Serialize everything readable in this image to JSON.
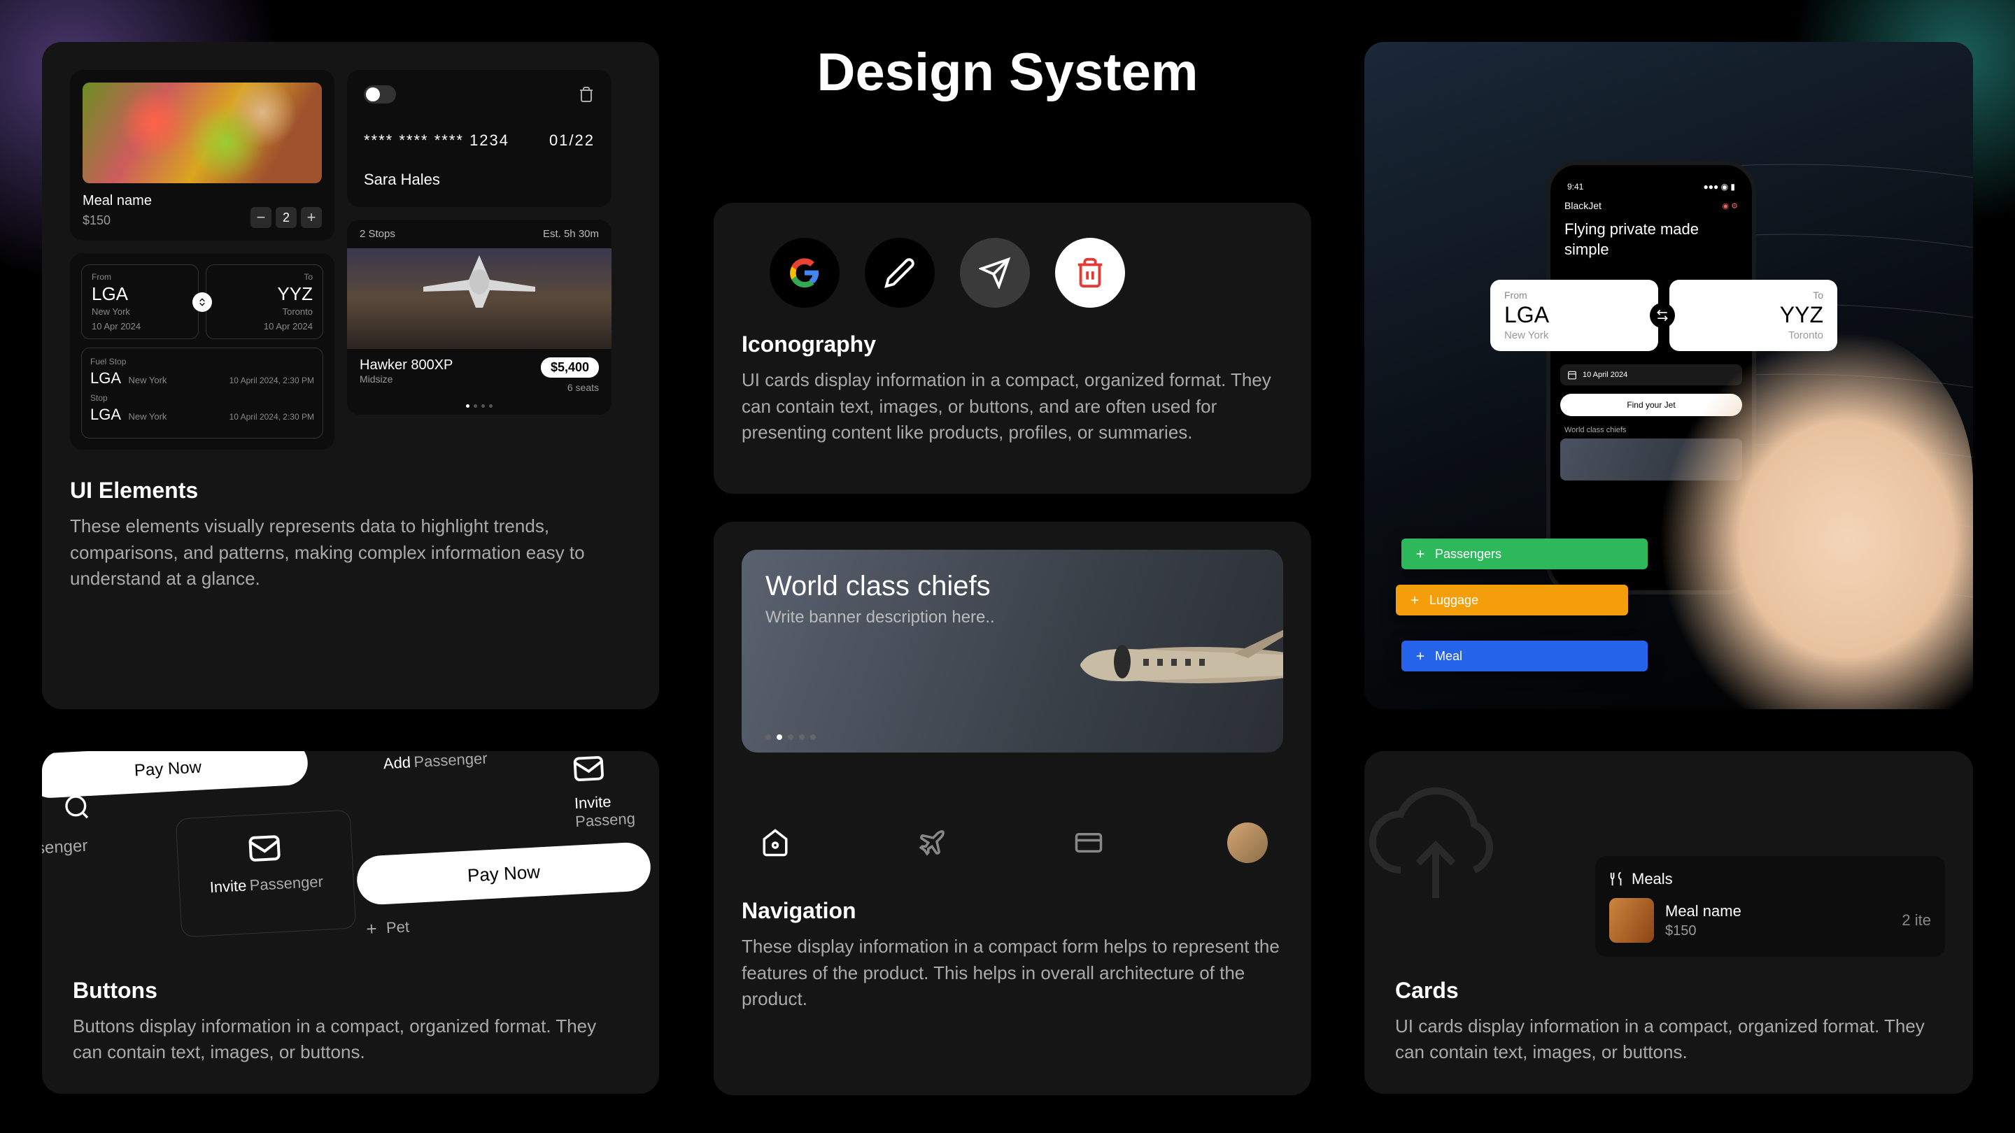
{
  "page_title": "Design System",
  "ui_elements": {
    "title": "UI Elements",
    "desc": "These elements visually represents data to highlight trends, comparisons, and patterns, making complex information easy to understand at a glance.",
    "meal": {
      "name": "Meal name",
      "price": "$150",
      "qty": "2"
    },
    "route": {
      "from_label": "From",
      "from_code": "LGA",
      "from_city": "New York",
      "from_date": "10 Apr 2024",
      "to_label": "To",
      "to_code": "YYZ",
      "to_city": "Toronto",
      "to_date": "10 Apr 2024",
      "fuel_label": "Fuel Stop",
      "fuel_code": "LGA",
      "fuel_city": "New York",
      "fuel_time": "10 April 2024, 2:30 PM",
      "stop_label": "Stop",
      "stop_code": "LGA",
      "stop_city": "New York",
      "stop_time": "10 April 2024, 2:30 PM"
    },
    "payment": {
      "masked": "**** **** **** 1234",
      "exp": "01/22",
      "name": "Sara Hales"
    },
    "jet": {
      "stops": "2 Stops",
      "eta": "Est. 5h 30m",
      "name": "Hawker 800XP",
      "class": "Midsize",
      "price": "$5,400",
      "seats": "6 seats"
    }
  },
  "iconography": {
    "title": "Iconography",
    "desc": "UI cards display information in a compact, organized format. They can contain text, images, or buttons, and are often used for presenting content like products, profiles, or summaries."
  },
  "navigation": {
    "title": "Navigation",
    "desc": "These display information in a compact form helps to represent the features of the product. This helps in overall architecture of the product.",
    "banner_title": "World class chiefs",
    "banner_sub": "Write banner description here.."
  },
  "hero": {
    "time": "9:41",
    "brand": "BlackJet",
    "headline": "Flying private made simple",
    "from_label": "From",
    "from_code": "LGA",
    "from_city": "New York",
    "to_label": "To",
    "to_code": "YYZ",
    "to_city": "Toronto",
    "date": "10 April 2024",
    "cta": "Find your Jet",
    "world": "World class chiefs",
    "chip_passengers": "Passengers",
    "chip_luggage": "Luggage",
    "chip_meal": "Meal"
  },
  "buttons": {
    "title": "Buttons",
    "desc": "Buttons display information in a compact, organized format. They can contain text, images, or buttons.",
    "pay_now": "Pay Now",
    "add": "Add",
    "passenger": "Passenger",
    "invite": "Invite",
    "passeng": "Passeng",
    "ssenger": "ssenger",
    "pet": "Pet"
  },
  "cards": {
    "title": "Cards",
    "desc": "UI cards display information in a compact, organized format. They can contain text, images, or buttons.",
    "meals_label": "Meals",
    "meal_name": "Meal name",
    "meal_price": "$150",
    "count": "2 ite"
  }
}
